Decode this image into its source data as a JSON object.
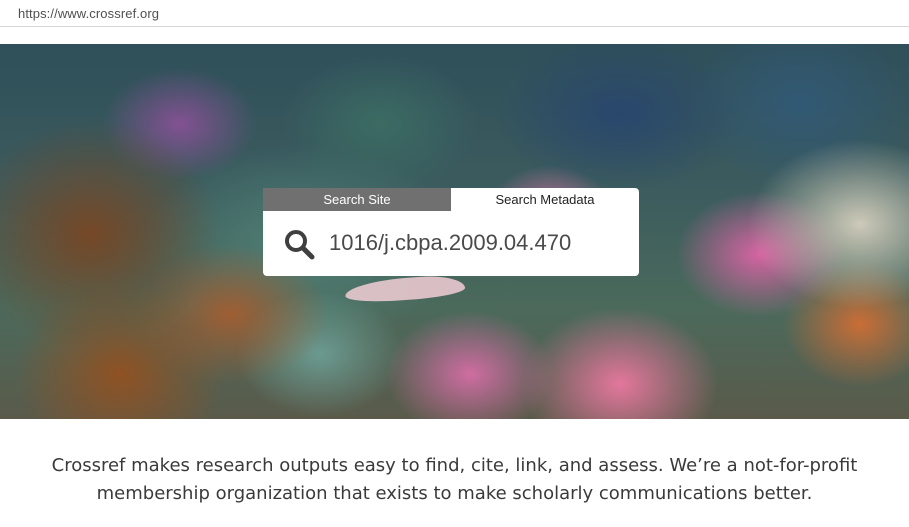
{
  "browser": {
    "url": "https://www.crossref.org"
  },
  "search": {
    "tabs": [
      {
        "label": "Search Site",
        "active": false
      },
      {
        "label": "Search Metadata",
        "active": true
      }
    ],
    "query": "1016/j.cbpa.2009.04.470",
    "icon": "search-icon"
  },
  "tagline": {
    "line1": "Crossref makes research outputs easy to find, cite, link, and assess. We’re a not-for-profit",
    "line2": "membership organization that exists to make scholarly communications better."
  },
  "colors": {
    "inactive_tab": "#707070",
    "active_tab": "#ffffff",
    "text": "#3a3a3a"
  }
}
